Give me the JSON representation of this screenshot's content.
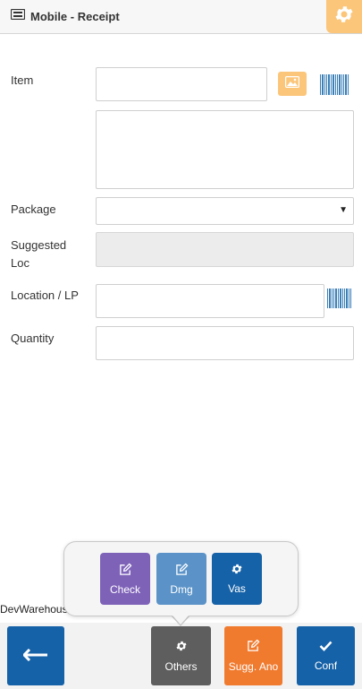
{
  "header": {
    "title": "Mobile - Receipt",
    "icon": "receipt-icon",
    "settings_icon": "gear-icon"
  },
  "form": {
    "item_label": "Item",
    "item_value": "",
    "item_description": "",
    "package_label": "Package",
    "package_value": "",
    "suggested_loc_label_line1": "Suggested",
    "suggested_loc_label_line2": "Loc",
    "suggested_loc_value": "",
    "location_label": "Location / LP",
    "location_value": "",
    "quantity_label": "Quantity",
    "quantity_value": ""
  },
  "popup": {
    "buttons": [
      {
        "label": "Check",
        "icon": "edit-icon",
        "color": "#7e62b8"
      },
      {
        "label": "Dmg",
        "icon": "edit-icon",
        "color": "#5b93c8"
      },
      {
        "label": "Vas",
        "icon": "gear-icon",
        "color": "#1662a8"
      }
    ]
  },
  "footer": {
    "warehouse": "DevWarehouse",
    "back_icon": "arrow-left-icon",
    "others_label": "Others",
    "sugg_label": "Sugg. Ano",
    "conf_label": "Conf"
  },
  "colors": {
    "accent_orange": "#fbc67a",
    "primary_blue": "#1662a8",
    "others_gray": "#5e5e5e",
    "sugg_orange": "#f07a2e",
    "barcode_blue": "#3a7fb8"
  }
}
